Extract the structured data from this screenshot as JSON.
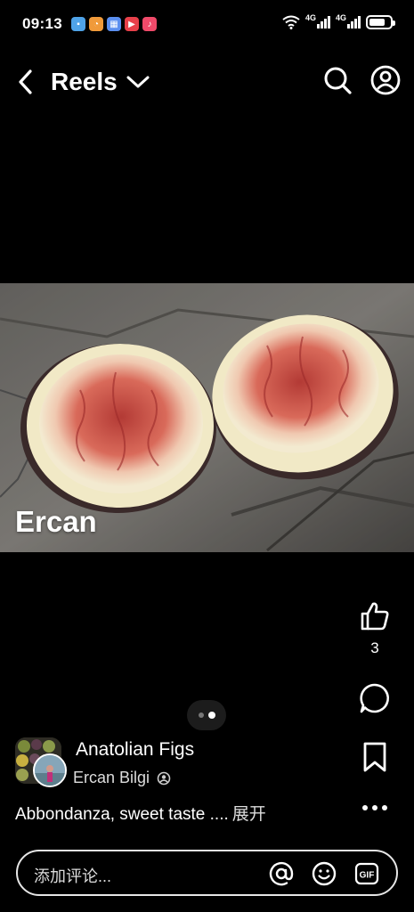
{
  "status_bar": {
    "time": "09:13",
    "network_1": "4G",
    "network_2": "4G",
    "battery_level": 0.75
  },
  "header": {
    "title": "Reels"
  },
  "media": {
    "watermark": "Ercan"
  },
  "side_actions": {
    "like_count": "3"
  },
  "pager": {
    "total": 2,
    "active": 2
  },
  "post": {
    "group_name": "Anatolian Figs",
    "author_name": "Ercan Bilgi",
    "caption": "Abbondanza, sweet taste ....",
    "expand_label": "展开"
  },
  "comment_bar": {
    "placeholder": "添加评论...",
    "gif_label": "GIF"
  },
  "colors": {
    "background": "#000000",
    "text": "#ffffff"
  }
}
